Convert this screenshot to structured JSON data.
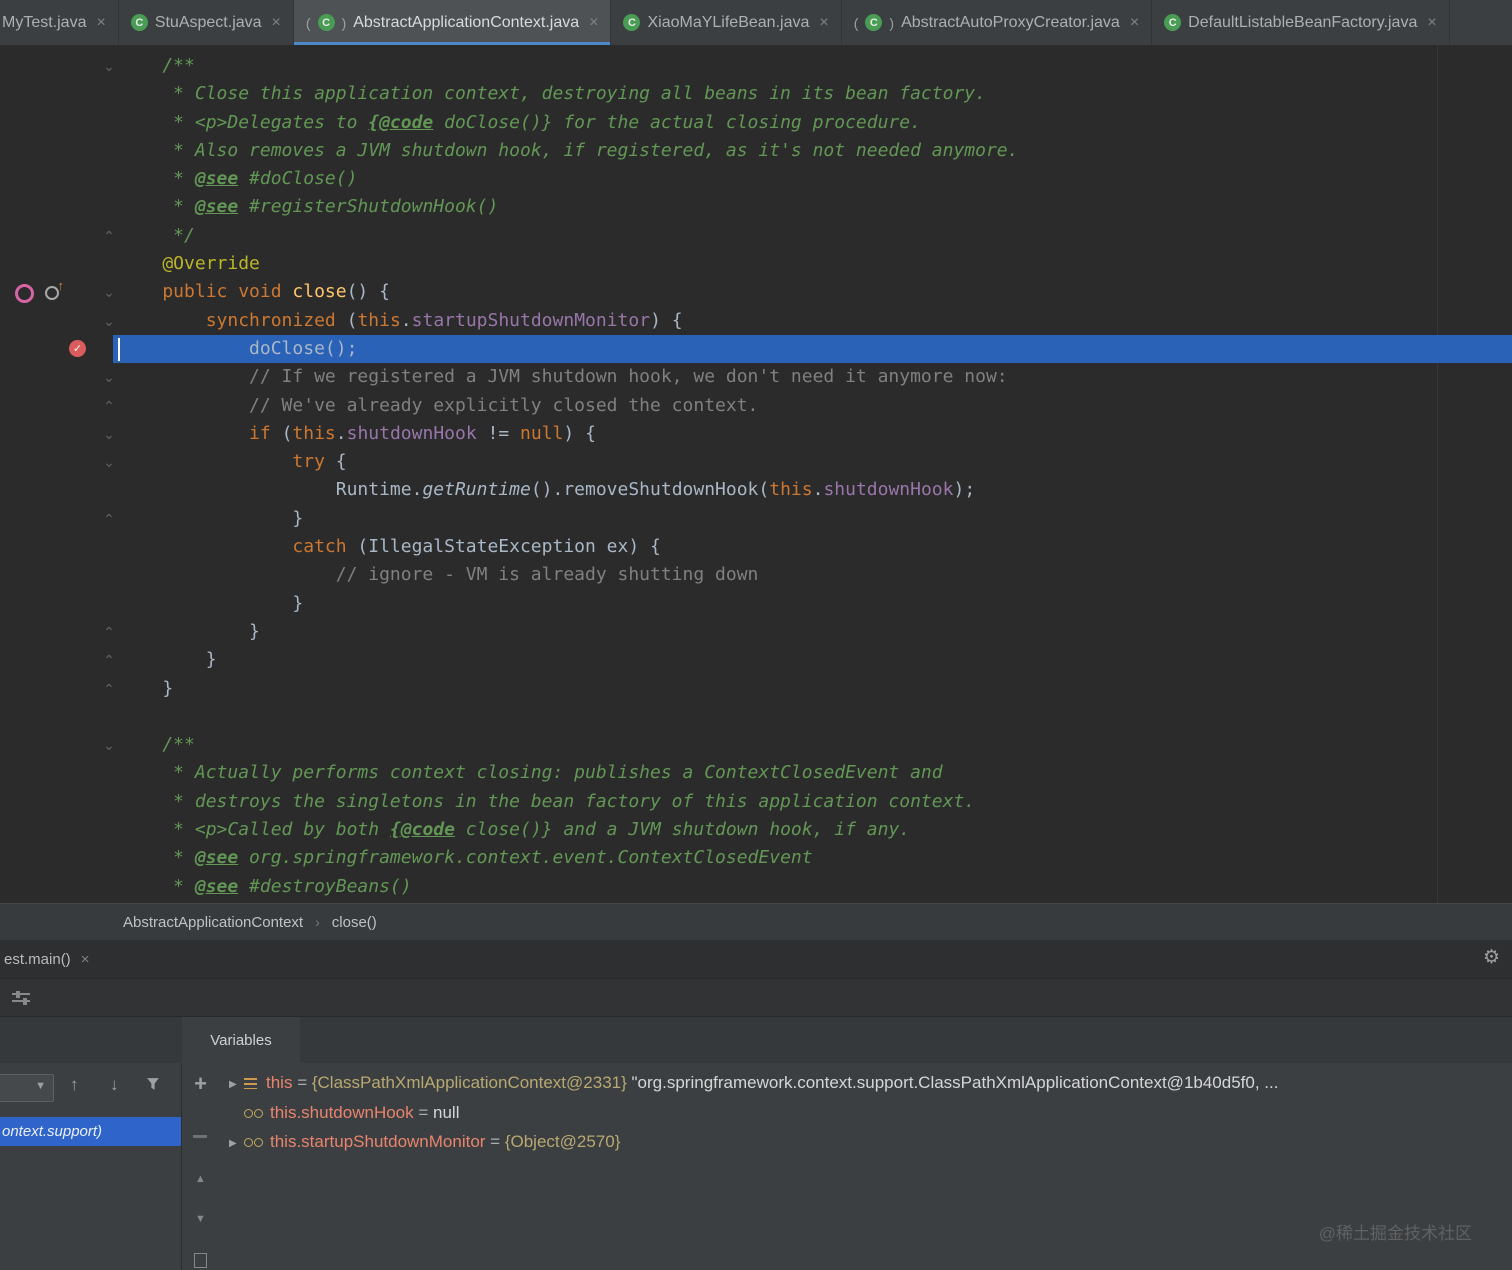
{
  "icons": {
    "class_letter": "C",
    "close": "×",
    "gear": "⚙",
    "combo_arrow": "▼",
    "up": "↑",
    "down": "↓",
    "expand": "▶",
    "tri_up": "▲",
    "tri_down": "▼",
    "fold_down": "⌄",
    "fold_up": "⌃",
    "check": "✓",
    "plus": "+",
    "chevron_sep": "›"
  },
  "colors": {
    "accent_blue": "#4a88c7",
    "execution_line_blue": "#2a62b8",
    "selection_blue": "#2f65ca",
    "breakpoint_red": "#db5c5c",
    "class_icon_green": "#499c54"
  },
  "tab_bar": {
    "tabs": [
      {
        "label": "MyTest.java",
        "kind": "class",
        "active": false
      },
      {
        "label": "StuAspect.java",
        "kind": "class",
        "active": false
      },
      {
        "label": "AbstractApplicationContext.java",
        "kind": "class-lib",
        "active": true
      },
      {
        "label": "XiaoMaYLifeBean.java",
        "kind": "class",
        "active": false
      },
      {
        "label": "AbstractAutoProxyCreator.java",
        "kind": "class-lib",
        "active": false
      },
      {
        "label": "DefaultListableBeanFactory.java",
        "kind": "class",
        "active": false
      }
    ]
  },
  "editor": {
    "current_line": 11,
    "breakpoint_line": 11,
    "fold_markers": [
      [
        1,
        "down"
      ],
      [
        7,
        "up"
      ],
      [
        9,
        "down"
      ],
      [
        10,
        "down"
      ],
      [
        12,
        "down"
      ],
      [
        13,
        "up"
      ],
      [
        14,
        "down"
      ],
      [
        15,
        "down"
      ],
      [
        17,
        "up"
      ],
      [
        21,
        "up"
      ],
      [
        22,
        "up"
      ],
      [
        23,
        "up"
      ],
      [
        25,
        "down"
      ]
    ],
    "lines": [
      [
        [
          "doc",
          "    /**"
        ]
      ],
      [
        [
          "doc",
          "     * Close this application context, destroying all beans in its bean factory."
        ]
      ],
      [
        [
          "doc",
          "     * <p>Delegates to "
        ],
        [
          "doctag",
          "{@code"
        ],
        [
          "doc",
          " doClose()} for the actual closing procedure."
        ]
      ],
      [
        [
          "doc",
          "     * Also removes a JVM shutdown hook, if registered, as it's not needed anymore."
        ]
      ],
      [
        [
          "doc",
          "     * "
        ],
        [
          "doctag",
          "@see"
        ],
        [
          "doc",
          " #doClose()"
        ]
      ],
      [
        [
          "doc",
          "     * "
        ],
        [
          "doctag",
          "@see"
        ],
        [
          "doc",
          " #registerShutdownHook()"
        ]
      ],
      [
        [
          "doc",
          "     */"
        ]
      ],
      [
        [
          "ann",
          "    @Override"
        ]
      ],
      [
        [
          "kw",
          "    public void "
        ],
        [
          "fn",
          "close"
        ],
        [
          "plain",
          "() {"
        ]
      ],
      [
        [
          "plain",
          "        "
        ],
        [
          "kw",
          "synchronized"
        ],
        [
          "plain",
          " ("
        ],
        [
          "kw",
          "this"
        ],
        [
          "plain",
          "."
        ],
        [
          "field",
          "startupShutdownMonitor"
        ],
        [
          "plain",
          ") {"
        ]
      ],
      [
        [
          "plain",
          "            doClose();"
        ]
      ],
      [
        [
          "cmt",
          "            // If we registered a JVM shutdown hook, we don't need it anymore now:"
        ]
      ],
      [
        [
          "cmt",
          "            // We've already explicitly closed the context."
        ]
      ],
      [
        [
          "plain",
          "            "
        ],
        [
          "kw",
          "if"
        ],
        [
          "plain",
          " ("
        ],
        [
          "kw",
          "this"
        ],
        [
          "plain",
          "."
        ],
        [
          "field",
          "shutdownHook"
        ],
        [
          "plain",
          " != "
        ],
        [
          "kw",
          "null"
        ],
        [
          "plain",
          ") {"
        ]
      ],
      [
        [
          "plain",
          "                "
        ],
        [
          "kw",
          "try"
        ],
        [
          "plain",
          " {"
        ]
      ],
      [
        [
          "plain",
          "                    Runtime."
        ],
        [
          "static",
          "getRuntime"
        ],
        [
          "plain",
          "().removeShutdownHook("
        ],
        [
          "kw",
          "this"
        ],
        [
          "plain",
          "."
        ],
        [
          "field",
          "shutdownHook"
        ],
        [
          "plain",
          ");"
        ]
      ],
      [
        [
          "plain",
          "                }"
        ]
      ],
      [
        [
          "plain",
          "                "
        ],
        [
          "kw",
          "catch"
        ],
        [
          "plain",
          " (IllegalStateException ex) {"
        ]
      ],
      [
        [
          "cmt",
          "                    // ignore - VM is already shutting down"
        ]
      ],
      [
        [
          "plain",
          "                }"
        ]
      ],
      [
        [
          "plain",
          "            }"
        ]
      ],
      [
        [
          "plain",
          "        }"
        ]
      ],
      [
        [
          "plain",
          "    }"
        ]
      ],
      [],
      [
        [
          "doc",
          "    /**"
        ]
      ],
      [
        [
          "doc",
          "     * Actually performs context closing: publishes a ContextClosedEvent and"
        ]
      ],
      [
        [
          "doc",
          "     * destroys the singletons in the bean factory of this application context."
        ]
      ],
      [
        [
          "doc",
          "     * <p>Called by both "
        ],
        [
          "doctag",
          "{@code"
        ],
        [
          "doc",
          " close()} and a JVM shutdown hook, if any."
        ]
      ],
      [
        [
          "doc",
          "     * "
        ],
        [
          "doctag",
          "@see"
        ],
        [
          "doc",
          " org.springframework.context.event.ContextClosedEvent"
        ]
      ],
      [
        [
          "doc",
          "     * "
        ],
        [
          "doctag",
          "@see"
        ],
        [
          "doc",
          " #destroyBeans()"
        ]
      ]
    ]
  },
  "breadcrumbs": {
    "items": [
      "AbstractApplicationContext",
      "close()"
    ]
  },
  "debugger": {
    "session_tab": "est.main()",
    "panel_tab": "Variables",
    "selected_frame": "ontext.support)",
    "equals_separator": " = ",
    "variables": [
      {
        "expandable": true,
        "icon": "object",
        "name": "this",
        "ref": "{ClassPathXmlApplicationContext@2331}",
        "value": "\"org.springframework.context.support.ClassPathXmlApplicationContext@1b40d5f0, ..."
      },
      {
        "expandable": false,
        "icon": "watch",
        "name": "this.shutdownHook",
        "ref": "",
        "value": "null"
      },
      {
        "expandable": true,
        "icon": "watch",
        "name": "this.startupShutdownMonitor",
        "ref": "{Object@2570}",
        "value": ""
      }
    ]
  },
  "watermark": "@稀土掘金技术社区"
}
